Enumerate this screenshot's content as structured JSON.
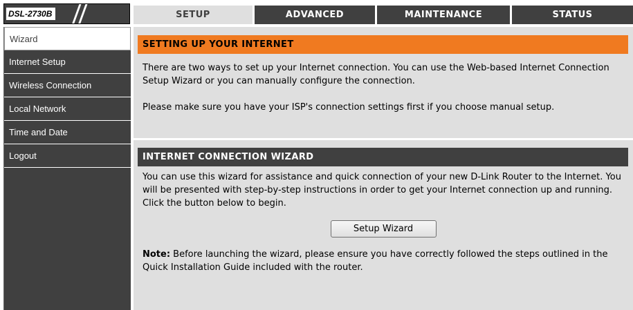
{
  "header": {
    "model": "DSL-2730B",
    "tabs": [
      {
        "label": "SETUP",
        "active": true
      },
      {
        "label": "ADVANCED",
        "active": false
      },
      {
        "label": "MAINTENANCE",
        "active": false
      },
      {
        "label": "STATUS",
        "active": false
      }
    ]
  },
  "sidebar": {
    "items": [
      {
        "label": "Wizard",
        "active": true
      },
      {
        "label": "Internet Setup",
        "active": false
      },
      {
        "label": "Wireless Connection",
        "active": false
      },
      {
        "label": "Local Network",
        "active": false
      },
      {
        "label": "Time and Date",
        "active": false
      },
      {
        "label": "Logout",
        "active": false
      }
    ]
  },
  "setup_section": {
    "title": "SETTING UP YOUR INTERNET",
    "paragraph1": "There are two ways to set up your Internet connection. You can use the Web-based Internet Connection Setup Wizard or you can manually configure the connection.",
    "paragraph2": "Please make sure you have your ISP's connection settings first if you choose manual setup."
  },
  "wizard_section": {
    "title": "INTERNET CONNECTION WIZARD",
    "description": "You can use this wizard for assistance and quick connection of your new D-Link Router to the Internet. You will be presented with step-by-step instructions in order to get your Internet connection up and running. Click the button below to begin.",
    "button_label": "Setup Wizard",
    "note_label": "Note:",
    "note_text": " Before launching the wizard, please ensure you have correctly followed the steps outlined in the Quick Installation Guide included with the router."
  },
  "colors": {
    "accent": "#f07a20",
    "dark": "#404040",
    "panel": "#dfdfdf"
  }
}
